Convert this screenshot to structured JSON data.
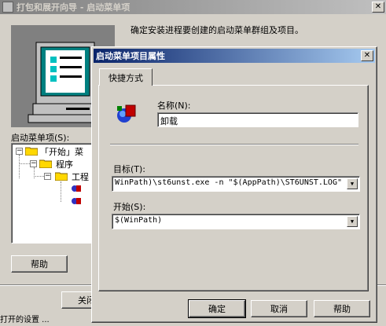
{
  "wizard": {
    "title": "打包和展开向导 - 启动菜单项",
    "instruction": "确定安装进程要创建的启动菜单群组及项目。",
    "tree_label": "启动菜单项(S):",
    "tree_items": [
      "「开始」菜",
      "程序",
      "工程"
    ],
    "help_label": "帮助",
    "close_label": "关闭",
    "footer_text": "打开的设置 ..."
  },
  "dialog": {
    "title": "启动菜单项目属性",
    "tab_label": "快捷方式",
    "name_label": "名称(N):",
    "name_value": "卸载",
    "target_label": "目标(T):",
    "target_value": "WinPath)\\st6unst.exe -n \"$(AppPath)\\ST6UNST.LOG\"",
    "start_label": "开始(S):",
    "start_value": "$(WinPath)",
    "ok_label": "确定",
    "cancel_label": "取消",
    "help_label": "帮助"
  },
  "colors": {
    "face": "#d4d0c8",
    "title_active": "#0a246a",
    "title_inactive": "#808080"
  }
}
